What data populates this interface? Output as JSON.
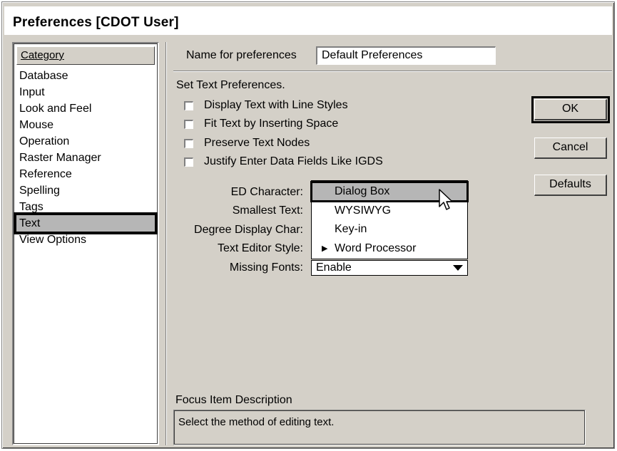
{
  "window": {
    "title": "Preferences [CDOT User]"
  },
  "category": {
    "header": "Category",
    "items": [
      "Database",
      "Input",
      "Look and Feel",
      "Mouse",
      "Operation",
      "Raster Manager",
      "Reference",
      "Spelling",
      "Tags",
      "Text",
      "View Options"
    ],
    "selected": "Text"
  },
  "name_field": {
    "label": "Name for preferences",
    "value": "Default Preferences"
  },
  "section": {
    "heading": "Set Text Preferences."
  },
  "checkboxes": [
    {
      "label": "Display Text with Line Styles",
      "checked": false
    },
    {
      "label": "Fit Text by Inserting Space",
      "checked": false
    },
    {
      "label": "Preserve Text Nodes",
      "checked": false
    },
    {
      "label": "Justify Enter Data Fields Like IGDS",
      "checked": false
    }
  ],
  "buttons": {
    "ok": "OK",
    "cancel": "Cancel",
    "defaults": "Defaults"
  },
  "fields": {
    "ed_character": "ED Character:",
    "smallest_text": "Smallest Text:",
    "degree_display_char": "Degree Display Char:",
    "text_editor_style": "Text Editor Style:",
    "missing_fonts": "Missing Fonts:"
  },
  "dropdown": {
    "options": [
      "Dialog Box",
      "WYSIWYG",
      "Key-in",
      "Word Processor"
    ],
    "highlighted": "Dialog Box",
    "current": "Word Processor"
  },
  "missing_fonts_value": "Enable",
  "focus": {
    "label": "Focus Item Description",
    "text": "Select the method of editing text."
  },
  "icons": {
    "cursor": "arrow-cursor-icon",
    "dropdown_arrow": "triangle-down-icon",
    "current_marker": "triangle-right-icon"
  }
}
